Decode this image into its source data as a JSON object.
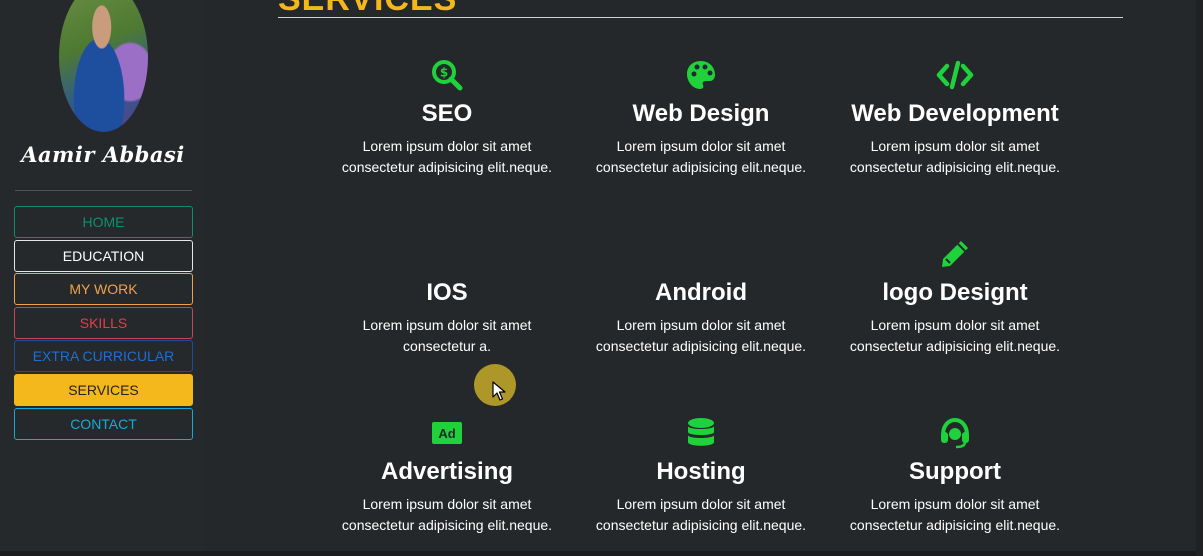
{
  "profile": {
    "name": "Aamir Abbasi"
  },
  "nav": [
    {
      "label": "HOME",
      "color": "#0d8f6f",
      "border": "#0d8f6f",
      "bg": "transparent"
    },
    {
      "label": "EDUCATION",
      "color": "#ffffff",
      "border": "#e6e6e6",
      "bg": "transparent"
    },
    {
      "label": "MY WORK",
      "color": "#f0a14b",
      "border": "#f0a14b",
      "bg": "transparent"
    },
    {
      "label": "SKILLS",
      "color": "#e23e48",
      "border": "#c7455d",
      "bg": "transparent"
    },
    {
      "label": "EXTRA CURRICULAR",
      "color": "#1b6fd8",
      "border": "#1b4f9a",
      "bg": "transparent"
    },
    {
      "label": "SERVICES",
      "color": "#222222",
      "border": "#f4b81c",
      "bg": "#f4b81c"
    },
    {
      "label": "CONTACT",
      "color": "#19a9d6",
      "border": "#19a9d6",
      "bg": "transparent"
    }
  ],
  "section": {
    "title": "SERVICES"
  },
  "accent_green": "#1fd13a",
  "services": [
    {
      "icon": "search-dollar-icon",
      "title": "SEO",
      "desc1": "Lorem ipsum dolor sit amet",
      "desc2": "consectetur adipisicing elit.neque."
    },
    {
      "icon": "palette-icon",
      "title": "Web Design",
      "desc1": "Lorem ipsum dolor sit amet",
      "desc2": "consectetur adipisicing elit.neque."
    },
    {
      "icon": "code-icon",
      "title": "Web Development",
      "desc1": "Lorem ipsum dolor sit amet",
      "desc2": "consectetur adipisicing elit.neque."
    },
    {
      "icon": "apple-icon",
      "title": "IOS",
      "desc1": "Lorem ipsum dolor sit amet",
      "desc2": "consectetur a."
    },
    {
      "icon": "android-icon",
      "title": "Android",
      "desc1": "Lorem ipsum dolor sit amet",
      "desc2": "consectetur adipisicing elit.neque."
    },
    {
      "icon": "pencil-icon",
      "title": "logo Designt",
      "desc1": "Lorem ipsum dolor sit amet",
      "desc2": "consectetur adipisicing elit.neque."
    },
    {
      "icon": "ad-icon",
      "title": "Advertising",
      "desc1": "Lorem ipsum dolor sit amet",
      "desc2": "consectetur adipisicing elit.neque.",
      "icon_text": "Ad"
    },
    {
      "icon": "database-icon",
      "title": "Hosting",
      "desc1": "Lorem ipsum dolor sit amet",
      "desc2": "consectetur adipisicing elit.neque."
    },
    {
      "icon": "headset-icon",
      "title": "Support",
      "desc1": "Lorem ipsum dolor sit amet",
      "desc2": "consectetur adipisicing elit.neque."
    }
  ]
}
